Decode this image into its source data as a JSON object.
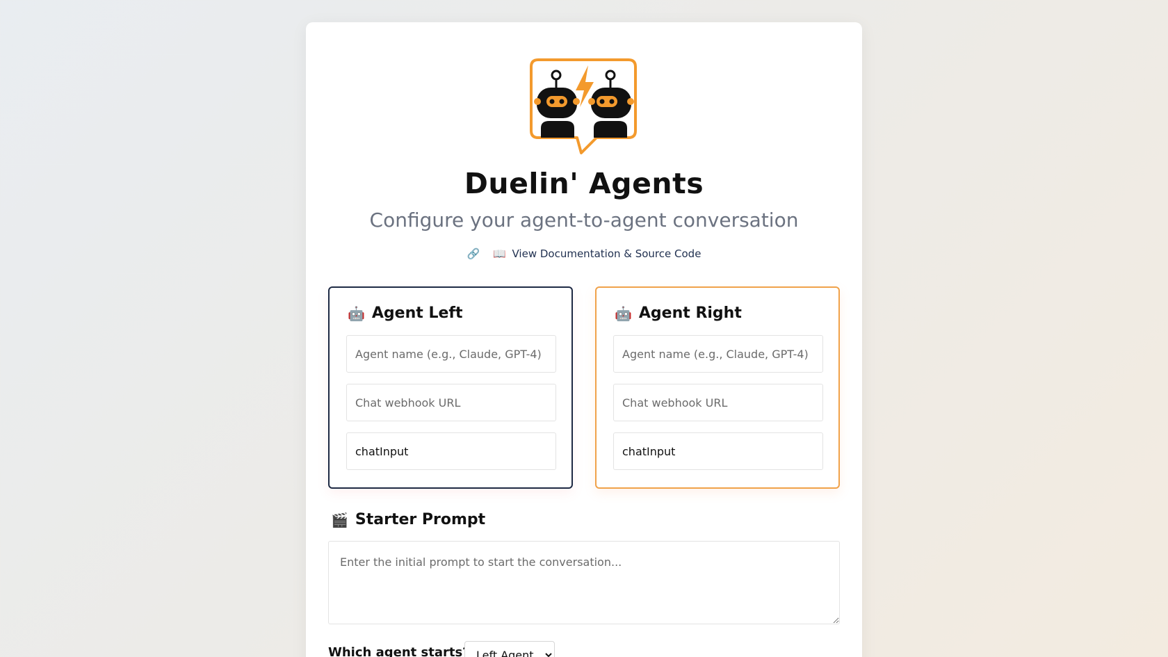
{
  "header": {
    "title": "Duelin' Agents",
    "subtitle": "Configure your agent-to-agent conversation",
    "doc_link_label": "View Documentation & Source Code",
    "doc_link_emoji": "📖",
    "chain_emoji": "🔗"
  },
  "agent_left": {
    "emoji": "🤖",
    "heading": "Agent Left",
    "name_placeholder": "Agent name (e.g., Claude, GPT-4)",
    "name_value": "",
    "webhook_placeholder": "Chat webhook URL",
    "webhook_value": "",
    "input_key_value": "chatInput"
  },
  "agent_right": {
    "emoji": "🤖",
    "heading": "Agent Right",
    "name_placeholder": "Agent name (e.g., Claude, GPT-4)",
    "name_value": "",
    "webhook_placeholder": "Chat webhook URL",
    "webhook_value": "",
    "input_key_value": "chatInput"
  },
  "starter": {
    "emoji": "🎬",
    "heading": "Starter Prompt",
    "placeholder": "Enter the initial prompt to start the conversation...",
    "value": ""
  },
  "starts": {
    "label": "Which agent starts?",
    "selected": "Left Agent"
  },
  "colors": {
    "left_border": "#1e2a44",
    "right_border": "#f0a24a",
    "logo_orange": "#f39a2d"
  },
  "icons": {
    "logo": "dueling-robots-logo-icon",
    "chain": "chain-link-icon",
    "book": "open-book-icon",
    "robot": "robot-icon",
    "clapper": "clapperboard-icon"
  }
}
